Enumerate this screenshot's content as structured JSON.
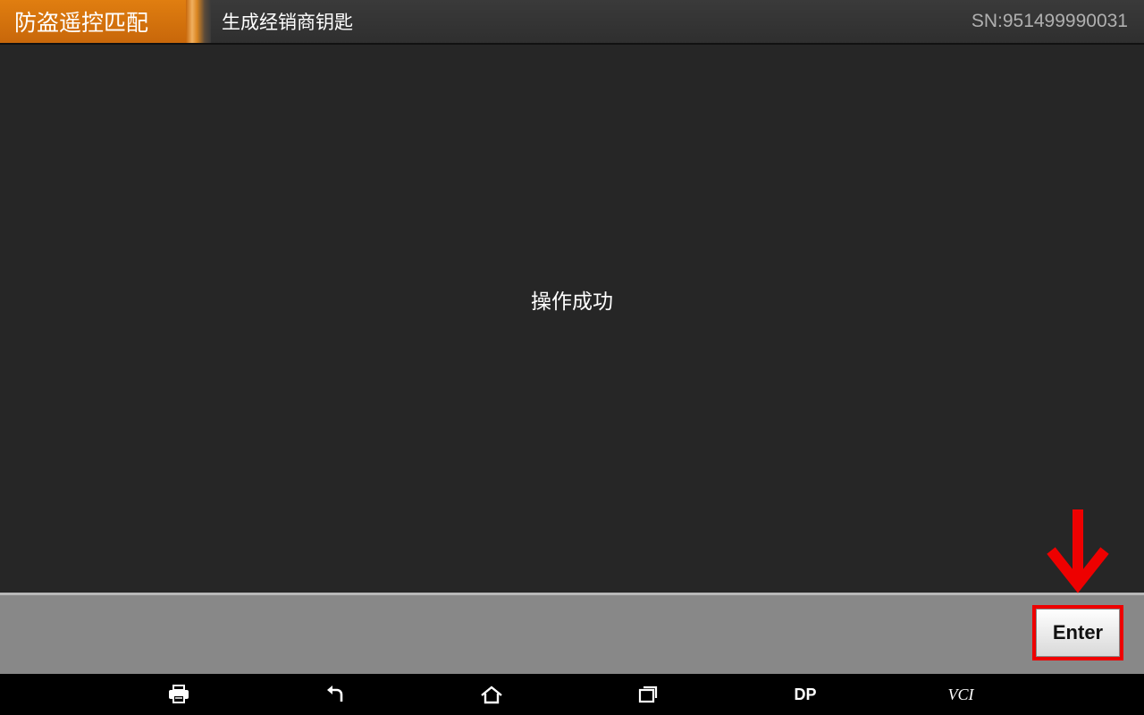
{
  "header": {
    "section": "防盗遥控匹配",
    "title": "生成经销商钥匙",
    "serial": "SN:951499990031"
  },
  "main": {
    "message": "操作成功"
  },
  "action_bar": {
    "enter_label": "Enter"
  },
  "nav_bar": {
    "items": [
      {
        "icon": "print-icon"
      },
      {
        "icon": "back-icon"
      },
      {
        "icon": "home-icon"
      },
      {
        "icon": "recent-apps-icon"
      },
      {
        "label": "DP"
      },
      {
        "label": "VCI"
      }
    ]
  },
  "colors": {
    "accent_orange": "#d9750c",
    "highlight_red": "#ee0000",
    "background": "#262626"
  }
}
